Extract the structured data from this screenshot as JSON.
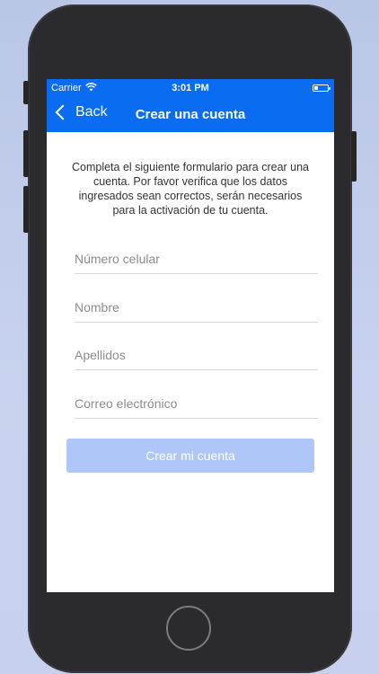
{
  "status_bar": {
    "carrier": "Carrier",
    "wifi_icon": "wifi-icon",
    "time": "3:01 PM",
    "battery_icon": "battery-icon"
  },
  "nav": {
    "back_label": "Back",
    "title": "Crear una cuenta"
  },
  "intro": "Completa el siguiente formulario para crear una cuenta. Por favor verifica que los datos ingresados sean correctos, serán necesarios para la activación de tu cuenta.",
  "form": {
    "phone_placeholder": "Número celular",
    "name_placeholder": "Nombre",
    "lastname_placeholder": "Apellidos",
    "email_placeholder": "Correo electrónico",
    "submit_label": "Crear mi cuenta"
  },
  "colors": {
    "nav_bg": "#0a6cf1",
    "submit_bg": "#afc7f8",
    "page_bg": "#c3cee9"
  }
}
